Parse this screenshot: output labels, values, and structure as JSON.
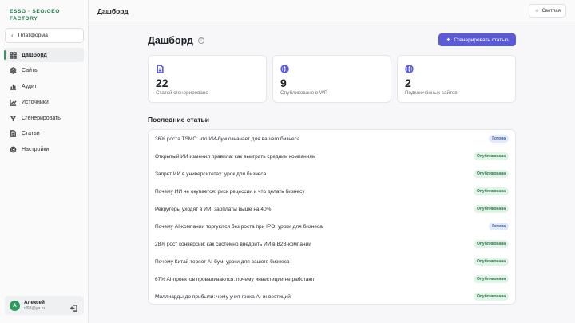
{
  "brand": "ESSG · SEO/GEO FACTORY",
  "platform_label": "Платформа",
  "nav": [
    {
      "label": "Дашборд",
      "icon": "grid-icon",
      "active": true
    },
    {
      "label": "Сайты",
      "icon": "layers-icon",
      "active": false
    },
    {
      "label": "Аудит",
      "icon": "chart-bars-icon",
      "active": false
    },
    {
      "label": "Источники",
      "icon": "trend-icon",
      "active": false
    },
    {
      "label": "Сгенерировать",
      "icon": "wand-icon",
      "active": false
    },
    {
      "label": "Статьи",
      "icon": "document-icon",
      "active": false
    },
    {
      "label": "Настройки",
      "icon": "gear-icon",
      "active": false
    }
  ],
  "user": {
    "name": "Алексей",
    "email": "cl93@ya.ru",
    "initial": "А"
  },
  "topbar": {
    "title": "Дашборд",
    "theme_label": "Светлая"
  },
  "main": {
    "title": "Дашборд",
    "help": "?",
    "generate_label": "Сгенерировать статью"
  },
  "stats": [
    {
      "value": "22",
      "label": "Статей сгенерировано",
      "icon": "document-icon"
    },
    {
      "value": "9",
      "label": "Опубликовано в WP",
      "icon": "globe-icon"
    },
    {
      "value": "2",
      "label": "Подключённых сайтов",
      "icon": "globe-icon"
    }
  ],
  "recent": {
    "title": "Последние статьи",
    "items": [
      {
        "title": "36% роста TSMC: что ИИ-бум означает для вашего бизнеса",
        "status": "Готова",
        "kind": "ready"
      },
      {
        "title": "Открытый ИИ изменил правила: как выиграть средним компаниям",
        "status": "Опубликована",
        "kind": "pub"
      },
      {
        "title": "Запрет ИИ в университетах: урок для бизнеса",
        "status": "Опубликована",
        "kind": "pub"
      },
      {
        "title": "Почему ИИ не окупается: риск рецессии и что делать бизнесу",
        "status": "Опубликована",
        "kind": "pub"
      },
      {
        "title": "Рекрутеры уходят в ИИ: зарплаты выше на 40%",
        "status": "Опубликована",
        "kind": "pub"
      },
      {
        "title": "Почему AI-компании торгуются без роста при IPO: уроки для бизнеса",
        "status": "Готова",
        "kind": "ready"
      },
      {
        "title": "28% рост конверсии: как системно внедрить ИИ в B2B-компании",
        "status": "Опубликована",
        "kind": "pub"
      },
      {
        "title": "Почему Китай теряет AI-бум: уроки для вашего бизнеса",
        "status": "Опубликована",
        "kind": "pub"
      },
      {
        "title": "67% AI-проектов проваливаются: почему инвестиции не работают",
        "status": "Опубликована",
        "kind": "pub"
      },
      {
        "title": "Миллиарды до прибыли: чему учит гонка AI-инвестиций",
        "status": "Опубликована",
        "kind": "pub"
      }
    ]
  }
}
